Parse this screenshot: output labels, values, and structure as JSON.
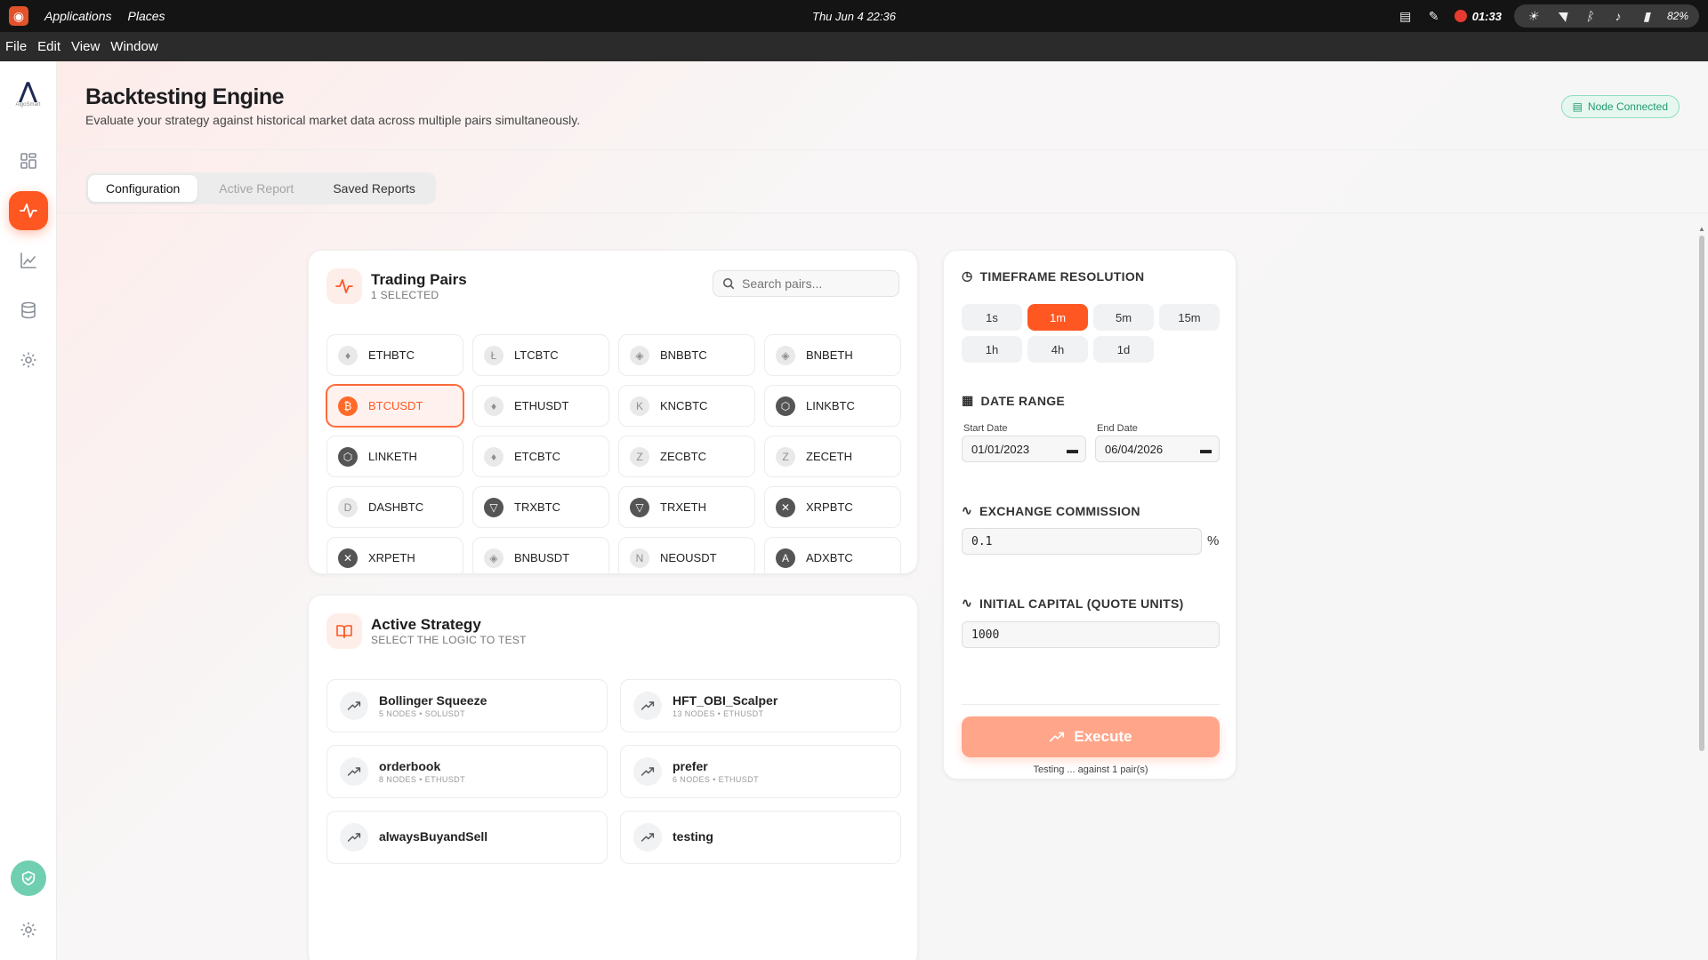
{
  "system_bar": {
    "applications": "Applications",
    "places": "Places",
    "clock": "Thu Jun 4  22:36",
    "record_time": "01:33",
    "battery": "82%"
  },
  "menubar": {
    "items": [
      "File",
      "Edit",
      "View",
      "Window"
    ]
  },
  "sidebar": {
    "brand_sub": "AlgoSmart",
    "items": [
      "dashboard-grid-icon",
      "activity-icon",
      "chart-line-icon",
      "database-icon",
      "settings-icon"
    ],
    "active_index": 1
  },
  "header": {
    "title": "Backtesting Engine",
    "subtitle": "Evaluate your strategy against historical market data across multiple pairs simultaneously.",
    "status": "Node Connected",
    "status_color": "#1f9c6e"
  },
  "tabs": [
    {
      "label": "Configuration"
    },
    {
      "label": "Active Report"
    },
    {
      "label": "Saved Reports"
    }
  ],
  "trading_pairs": {
    "title": "Trading Pairs",
    "count_label": "1 SELECTED",
    "search_placeholder": "Search pairs...",
    "pairs": [
      {
        "name": "ETHBTC",
        "icon": "ethereum-icon",
        "glyph": "♦",
        "selected": false
      },
      {
        "name": "LTCBTC",
        "icon": "litecoin-icon",
        "glyph": "Ł",
        "selected": false
      },
      {
        "name": "BNBBTC",
        "icon": "bnb-icon",
        "glyph": "◈",
        "selected": false
      },
      {
        "name": "BNBETH",
        "icon": "bnb-icon",
        "glyph": "◈",
        "selected": false
      },
      {
        "name": "BTCUSDT",
        "icon": "bitcoin-icon",
        "glyph": "₿",
        "selected": true
      },
      {
        "name": "ETHUSDT",
        "icon": "ethereum-icon",
        "glyph": "♦",
        "selected": false
      },
      {
        "name": "KNCBTC",
        "icon": "kyber-icon",
        "glyph": "K",
        "selected": false
      },
      {
        "name": "LINKBTC",
        "icon": "chainlink-icon",
        "glyph": "⬡",
        "selected": false,
        "dark": true
      },
      {
        "name": "LINKETH",
        "icon": "chainlink-icon",
        "glyph": "⬡",
        "selected": false,
        "dark": true
      },
      {
        "name": "ETCBTC",
        "icon": "ethereum-classic-icon",
        "glyph": "♦",
        "selected": false
      },
      {
        "name": "ZECBTC",
        "icon": "zcash-icon",
        "glyph": "Z",
        "selected": false
      },
      {
        "name": "ZECETH",
        "icon": "zcash-icon",
        "glyph": "Z",
        "selected": false
      },
      {
        "name": "DASHBTC",
        "icon": "dash-icon",
        "glyph": "D",
        "selected": false
      },
      {
        "name": "TRXBTC",
        "icon": "tron-icon",
        "glyph": "▽",
        "selected": false,
        "dark": true
      },
      {
        "name": "TRXETH",
        "icon": "tron-icon",
        "glyph": "▽",
        "selected": false,
        "dark": true
      },
      {
        "name": "XRPBTC",
        "icon": "xrp-icon",
        "glyph": "✕",
        "selected": false,
        "dark": true
      },
      {
        "name": "XRPETH",
        "icon": "xrp-icon",
        "glyph": "✕",
        "selected": false,
        "dark": true
      },
      {
        "name": "BNBUSDT",
        "icon": "bnb-icon",
        "glyph": "◈",
        "selected": false
      },
      {
        "name": "NEOUSDT",
        "icon": "neo-icon",
        "glyph": "N",
        "selected": false
      },
      {
        "name": "ADXBTC",
        "icon": "adx-icon",
        "glyph": "A",
        "selected": false,
        "dark": true
      }
    ]
  },
  "active_strategy": {
    "title": "Active Strategy",
    "subtitle": "SELECT THE LOGIC TO TEST",
    "strategies": [
      {
        "name": "Bollinger Squeeze",
        "meta": "5 NODES • SOLUSDT"
      },
      {
        "name": "HFT_OBI_Scalper",
        "meta": "13 NODES • ETHUSDT"
      },
      {
        "name": "orderbook",
        "meta": "8 NODES • ETHUSDT"
      },
      {
        "name": "prefer",
        "meta": "6 NODES • ETHUSDT"
      },
      {
        "name": "alwaysBuyandSell",
        "meta": ""
      },
      {
        "name": "testing",
        "meta": ""
      }
    ]
  },
  "settings": {
    "timeframe_label": "TIMEFRAME RESOLUTION",
    "timeframes": [
      "1s",
      "1m",
      "5m",
      "15m",
      "1h",
      "4h",
      "1d"
    ],
    "selected_timeframe": "1m",
    "date_range_label": "DATE RANGE",
    "start_label": "Start Date",
    "start_value": "01/01/2023",
    "end_label": "End Date",
    "end_value": "06/04/2026",
    "commission_label": "EXCHANGE COMMISSION",
    "commission_value": "0.1",
    "commission_unit": "%",
    "capital_label": "INITIAL CAPITAL (QUOTE UNITS)",
    "capital_value": "1000",
    "execute_label": "Execute",
    "execute_note": "Testing ... against 1 pair(s)",
    "accent_color": "#ff5722"
  }
}
